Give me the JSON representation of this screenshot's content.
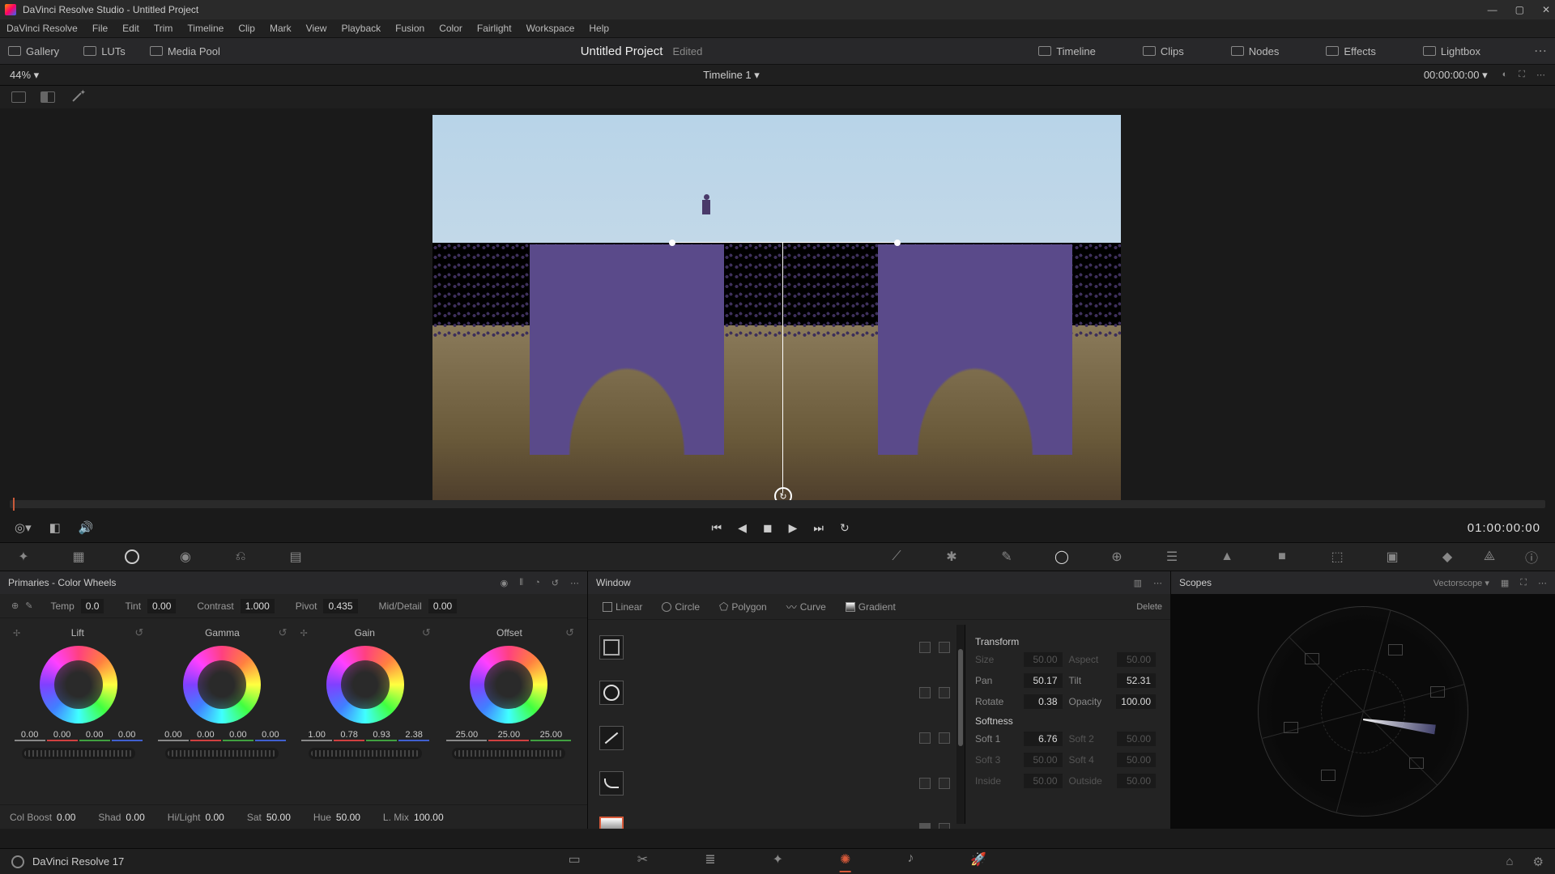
{
  "titlebar": {
    "app": "DaVinci Resolve Studio",
    "project": "Untitled Project"
  },
  "menubar": [
    "DaVinci Resolve",
    "File",
    "Edit",
    "Trim",
    "Timeline",
    "Clip",
    "Mark",
    "View",
    "Playback",
    "Fusion",
    "Color",
    "Fairlight",
    "Workspace",
    "Help"
  ],
  "toolrow": {
    "left": [
      "Gallery",
      "LUTs",
      "Media Pool"
    ],
    "title": "Untitled Project",
    "status": "Edited",
    "right": [
      "Timeline",
      "Clips",
      "Nodes",
      "Effects",
      "Lightbox"
    ]
  },
  "zoom": {
    "pct": "44%",
    "timeline_name": "Timeline 1",
    "tc": "00:00:00:00"
  },
  "transport": {
    "tc": "01:00:00:00"
  },
  "primaries": {
    "title": "Primaries - Color Wheels",
    "top": {
      "temp_l": "Temp",
      "temp": "0.0",
      "tint_l": "Tint",
      "tint": "0.00",
      "contrast_l": "Contrast",
      "contrast": "1.000",
      "pivot_l": "Pivot",
      "pivot": "0.435",
      "mid_l": "Mid/Detail",
      "mid": "0.00"
    },
    "wheels": {
      "lift": {
        "name": "Lift",
        "v": [
          "0.00",
          "0.00",
          "0.00",
          "0.00"
        ]
      },
      "gamma": {
        "name": "Gamma",
        "v": [
          "0.00",
          "0.00",
          "0.00",
          "0.00"
        ]
      },
      "gain": {
        "name": "Gain",
        "v": [
          "1.00",
          "0.78",
          "0.93",
          "2.38"
        ]
      },
      "offset": {
        "name": "Offset",
        "v": [
          "25.00",
          "25.00",
          "25.00"
        ]
      }
    },
    "bot": {
      "colboost_l": "Col Boost",
      "colboost": "0.00",
      "shad_l": "Shad",
      "shad": "0.00",
      "hilight_l": "Hi/Light",
      "hilight": "0.00",
      "sat_l": "Sat",
      "sat": "50.00",
      "hue_l": "Hue",
      "hue": "50.00",
      "lmix_l": "L. Mix",
      "lmix": "100.00"
    }
  },
  "window": {
    "title": "Window",
    "shapes": {
      "linear": "Linear",
      "circle": "Circle",
      "polygon": "Polygon",
      "curve": "Curve",
      "gradient": "Gradient",
      "delete": "Delete"
    }
  },
  "transform": {
    "title": "Transform",
    "size_l": "Size",
    "size": "50.00",
    "aspect_l": "Aspect",
    "aspect": "50.00",
    "pan_l": "Pan",
    "pan": "50.17",
    "tilt_l": "Tilt",
    "tilt": "52.31",
    "rotate_l": "Rotate",
    "rotate": "0.38",
    "opacity_l": "Opacity",
    "opacity": "100.00"
  },
  "softness": {
    "title": "Softness",
    "s1_l": "Soft 1",
    "s1": "6.76",
    "s2_l": "Soft 2",
    "s2": "50.00",
    "s3_l": "Soft 3",
    "s3": "50.00",
    "s4_l": "Soft 4",
    "s4": "50.00",
    "inside_l": "Inside",
    "inside": "50.00",
    "outside_l": "Outside",
    "outside": "50.00"
  },
  "scopes": {
    "title": "Scopes",
    "type": "Vectorscope"
  },
  "footer": {
    "ver": "DaVinci Resolve 17"
  }
}
